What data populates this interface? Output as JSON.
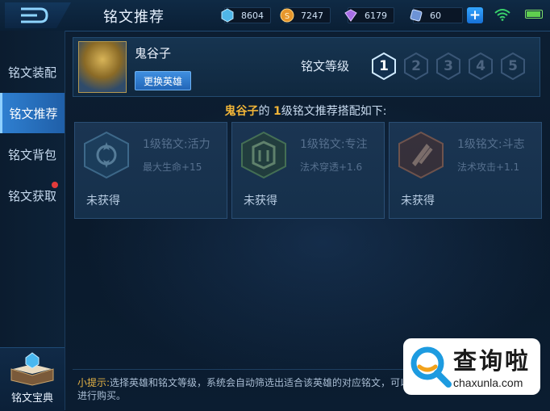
{
  "header": {
    "title": "铭文推荐",
    "resources": [
      {
        "icon": "diamond-icon",
        "value": "8604",
        "color": "#7fd3ff"
      },
      {
        "icon": "gold-coin-icon",
        "value": "7247",
        "color": "#f0a93a"
      },
      {
        "icon": "gem-icon",
        "value": "6179",
        "color": "#c98cff"
      },
      {
        "icon": "ticket-icon",
        "value": "60",
        "color": "#9ec3ff"
      }
    ],
    "plus_label": "+"
  },
  "sidebar": {
    "items": [
      {
        "label": "铭文装配",
        "active": false
      },
      {
        "label": "铭文推荐",
        "active": true
      },
      {
        "label": "铭文背包",
        "active": false
      },
      {
        "label": "铭文获取",
        "active": false,
        "badge": true
      }
    ],
    "codex_label": "铭文宝典"
  },
  "hero": {
    "name": "鬼谷子",
    "change_label": "更换英雄",
    "level_label": "铭文等级",
    "levels": [
      "1",
      "2",
      "3",
      "4",
      "5"
    ],
    "selected_level": "1"
  },
  "recommendation": {
    "hero": "鬼谷子",
    "mid": "的 ",
    "level": "1",
    "suffix": "级铭文推荐搭配如下:"
  },
  "runes": [
    {
      "name": "1级铭文:活力",
      "stat": "最大生命+15",
      "status": "未获得",
      "icon": "vitality-rune-icon",
      "color": "#4f8fb8"
    },
    {
      "name": "1级铭文:专注",
      "stat": "法术穿透+1.6",
      "status": "未获得",
      "icon": "focus-rune-icon",
      "color": "#5fa34a"
    },
    {
      "name": "1级铭文:斗志",
      "stat": "法术攻击+1.1",
      "status": "未获得",
      "icon": "fighting-spirit-rune-icon",
      "color": "#c66a3a"
    }
  ],
  "hint": {
    "label": "小提示:",
    "text": "选择英雄和铭文等级，系统会自动筛选出适合该英雄的对应铭文，可以直接进行购买。"
  },
  "watermark": {
    "cn": "查询啦",
    "en": "chaxunla.com"
  }
}
